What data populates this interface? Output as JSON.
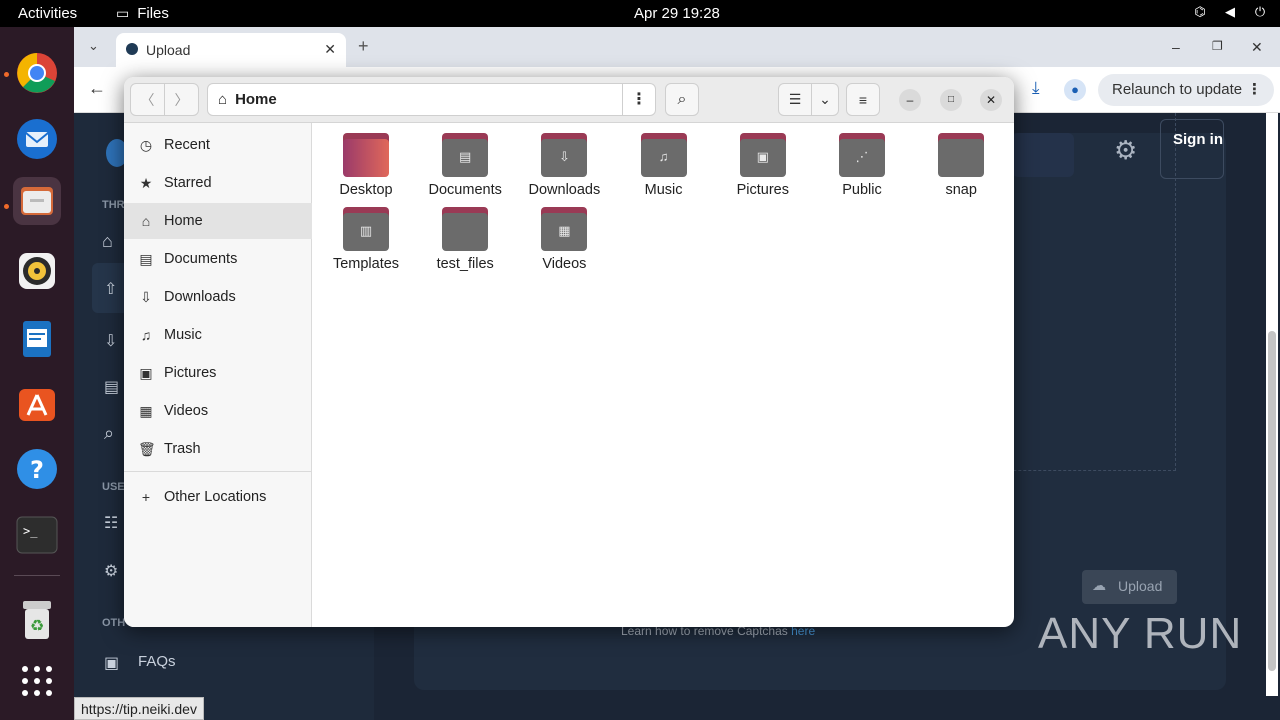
{
  "topbar": {
    "activities": "Activities",
    "app_name": "Files",
    "clock": "Apr 29  19:28"
  },
  "browser": {
    "tab_title": "Upload",
    "relaunch_label": "Relaunch to update",
    "signin_label": "Sign in",
    "upload_label": "Upload",
    "captcha_text": "Learn how to remove Captchas",
    "captcha_link": "here",
    "watermark": "ANY RUN",
    "status_url": "https://tip.neiki.dev",
    "faqs_label": "FAQs",
    "section_labels": [
      "THR",
      "USE",
      "OTH"
    ]
  },
  "files": {
    "path_label": "Home",
    "places": [
      {
        "label": "Recent",
        "icon": "clock-icon",
        "glyph": "◷"
      },
      {
        "label": "Starred",
        "icon": "star-icon",
        "glyph": "★"
      },
      {
        "label": "Home",
        "icon": "home-icon",
        "glyph": "⌂"
      },
      {
        "label": "Documents",
        "icon": "document-icon",
        "glyph": "▤"
      },
      {
        "label": "Downloads",
        "icon": "download-icon",
        "glyph": "⇩"
      },
      {
        "label": "Music",
        "icon": "music-icon",
        "glyph": "♫"
      },
      {
        "label": "Pictures",
        "icon": "picture-icon",
        "glyph": "▣"
      },
      {
        "label": "Videos",
        "icon": "video-icon",
        "glyph": "▦"
      },
      {
        "label": "Trash",
        "icon": "trash-icon",
        "glyph": "🗑"
      }
    ],
    "selected_place": "Home",
    "other_locations": "Other Locations",
    "folders": [
      {
        "name": "Desktop",
        "emblem": "",
        "color": "#d05a6a"
      },
      {
        "name": "Documents",
        "emblem": "▤",
        "color": "#6b6b6b"
      },
      {
        "name": "Downloads",
        "emblem": "⇩",
        "color": "#6b6b6b"
      },
      {
        "name": "Music",
        "emblem": "♫",
        "color": "#6b6b6b"
      },
      {
        "name": "Pictures",
        "emblem": "▣",
        "color": "#6b6b6b"
      },
      {
        "name": "Public",
        "emblem": "⋰",
        "color": "#6b6b6b"
      },
      {
        "name": "snap",
        "emblem": "",
        "color": "#6b6b6b"
      },
      {
        "name": "Templates",
        "emblem": "▥",
        "color": "#6b6b6b"
      },
      {
        "name": "test_files",
        "emblem": "",
        "color": "#6b6b6b"
      },
      {
        "name": "Videos",
        "emblem": "▦",
        "color": "#6b6b6b"
      }
    ],
    "folder_tab_color": "#9a3a55"
  }
}
